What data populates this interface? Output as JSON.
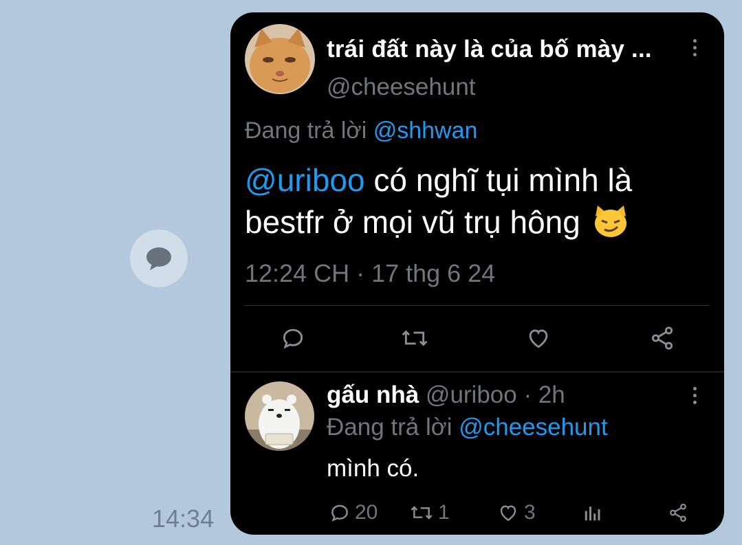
{
  "chat": {
    "message_time": "14:34",
    "share_icon": "speech-bubble-icon"
  },
  "tweet": {
    "author_name": "trái đất này là của bố mày ...",
    "author_handle": "@cheesehunt",
    "reply_prefix": "Đang trả lời ",
    "reply_to": "@shhwan",
    "mention": "@uriboo",
    "text": " có nghĩ tụi mình là bestfr ở mọi vũ trụ hông",
    "emoji": "smirking-cat-icon",
    "timestamp": "12:24 CH · 17 thg 6 24",
    "actions": [
      "reply-icon",
      "retweet-icon",
      "like-icon",
      "share-icon"
    ]
  },
  "reply": {
    "author_name": "gấu nhà",
    "author_handle": " @uriboo · 2h",
    "reply_prefix": "Đang trả lời ",
    "reply_to": "@cheesehunt",
    "text": "mình có.",
    "reply_count": "20",
    "retweet_count": "1",
    "like_count": "3"
  },
  "colors": {
    "background": "#b3c8dc",
    "card": "#000000",
    "link": "#1d9bf0",
    "muted": "#71767b"
  }
}
